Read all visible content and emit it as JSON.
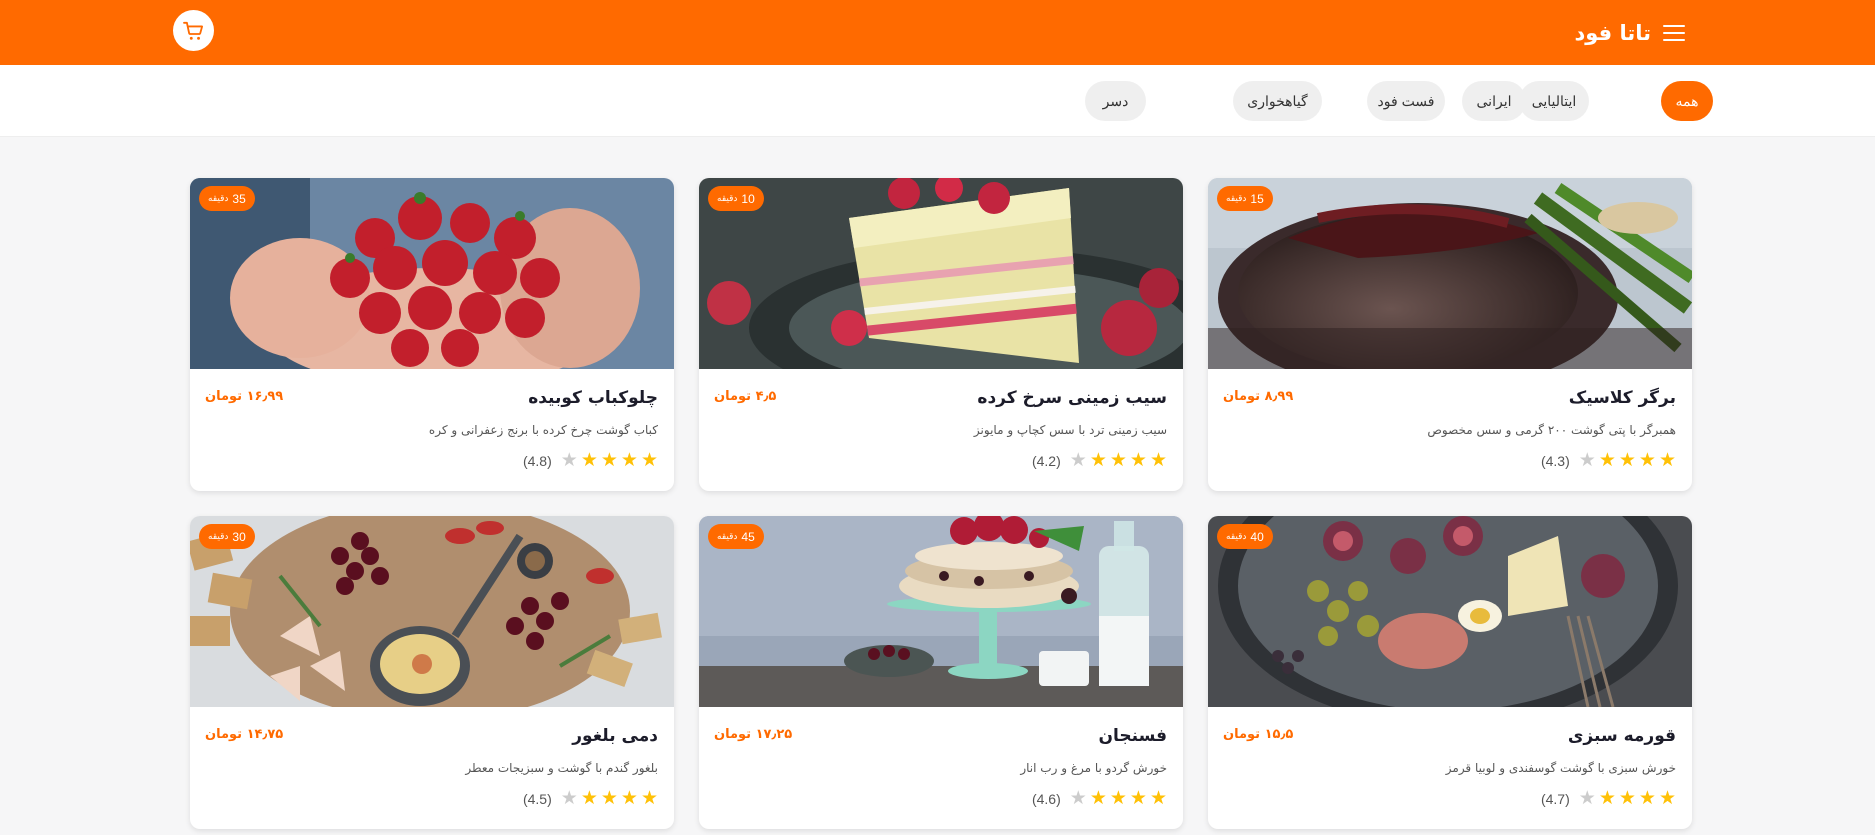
{
  "header": {
    "brand": "تاتا فود",
    "menu_icon": "hamburger-menu-icon",
    "cart_icon": "shopping-cart-icon",
    "accent_color": "#ff6a00"
  },
  "categories": [
    {
      "label": "همه",
      "active": true
    },
    {
      "label": "ایتالیایی",
      "active": false
    },
    {
      "label": "ایرانی",
      "active": false
    },
    {
      "label": "فست فود",
      "active": false
    },
    {
      "label": "گیاهخواری",
      "active": false
    },
    {
      "label": "دسر",
      "active": false
    }
  ],
  "time_unit": "دقیقه",
  "items": [
    {
      "name": "برگر کلاسیک",
      "price": "۸٫۹۹ تومان",
      "description": "همبرگر با پتی گوشت ۲۰۰ گرمی و سس مخصوص",
      "rating": 4.3,
      "rating_text": "(4.3)",
      "stars": 4,
      "time": "15",
      "image": "steak-with-asparagus"
    },
    {
      "name": "سیب زمینی سرخ کرده",
      "price": "۴٫۵ تومان",
      "description": "سیب زمینی ترد با سس کچاپ و مایونز",
      "rating": 4.2,
      "rating_text": "(4.2)",
      "stars": 4,
      "time": "10",
      "image": "raspberry-layer-cake"
    },
    {
      "name": "چلوکباب کوبیده",
      "price": "۱۶٫۹۹ تومان",
      "description": "کباب گوشت چرخ کرده با برنج زعفرانی و کره",
      "rating": 4.8,
      "rating_text": "(4.8)",
      "stars": 4,
      "time": "35",
      "image": "hands-holding-strawberries"
    },
    {
      "name": "قورمه سبزی",
      "price": "۱۵٫۵ تومان",
      "description": "خورش سبزی با گوشت گوسفندی و لوبیا قرمز",
      "rating": 4.7,
      "rating_text": "(4.7)",
      "stars": 4,
      "time": "40",
      "image": "figs-cheese-platter"
    },
    {
      "name": "فسنجان",
      "price": "۱۷٫۲۵ تومان",
      "description": "خورش گردو با مرغ و رب انار",
      "rating": 4.6,
      "rating_text": "(4.6)",
      "stars": 4,
      "time": "45",
      "image": "cake-on-mint-stand"
    },
    {
      "name": "دمی بلغور",
      "price": "۱۴٫۷۵ تومان",
      "description": "بلغور گندم با گوشت و سبزیجات معطر",
      "rating": 4.5,
      "rating_text": "(4.5)",
      "stars": 4,
      "time": "30",
      "image": "grazing-board-grapes-crackers"
    }
  ]
}
